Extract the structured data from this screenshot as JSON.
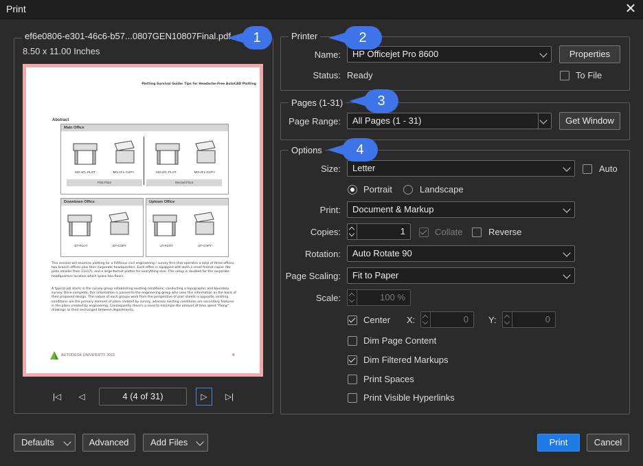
{
  "window": {
    "title": "Print",
    "close_icon": "close-icon"
  },
  "preview": {
    "file_name": "ef6e0806-e301-46c6-b57...0807GEN10807Final.pdf",
    "page_size": "8.50  x  11.00 Inches",
    "page_indicator": "4 (4 of 31)",
    "doc": {
      "header": "Plotting Survival Guide: Tips for Headache-Free AutoCAD Plotting",
      "heading": "Abstract",
      "main_office": "Main Office",
      "downtown_office": "Downtown Office",
      "uptown_office": "Uptown Office",
      "labels": [
        "MO-1FL-PLOT",
        "MO-1FL-COPY",
        "MO-2FL-PLOT",
        "MO-2FL-COPY",
        "DT-PLOT",
        "DT-COPY",
        "UT-PLOT",
        "UT-COPY"
      ],
      "first_floor": "First Floor",
      "second_floor": "Second Floor",
      "para1": "This session will examine plotting for a fictitious civil engineering / survey firm that operates a total of three offices; two branch offices plus their corporate headquarters. Each office is equipped with both a small format copier (for plots smaller than 11x17), and a large format plotter for everything else. This setup is doubled for the corporate headquarters location which spans two floors.",
      "para2": "A typical job starts in the survey group establishing existing conditions; conducting a topographic and boundary survey. Once complete, this information is passed to the engineering group who uses this information as the basis of their proposed design. The nature of each groups work from the perspective of plan sheets is opposite; existing conditions are the primary element of plans created by survey, whereas existing conditions are secondary features in the plans created by engineering. Consequently there's a need to minimize the amount of time spent \"fixing\" drawings as their exchanged between departments.",
      "footer_logo": "AUTODESK UNIVERSITY 2015",
      "page_number": "4"
    }
  },
  "printer": {
    "legend": "Printer",
    "name_label": "Name:",
    "name_value": "HP Officejet Pro 8600",
    "properties_button": "Properties",
    "status_label": "Status:",
    "status_value": "Ready",
    "to_file_label": "To File",
    "to_file_checked": false
  },
  "pages": {
    "legend": "Pages (1-31)",
    "range_label": "Page Range:",
    "range_value": "All Pages (1 - 31)",
    "get_window_button": "Get Window"
  },
  "options": {
    "legend": "Options",
    "size_label": "Size:",
    "size_value": "Letter",
    "auto_label": "Auto",
    "auto_checked": false,
    "portrait_label": "Portrait",
    "landscape_label": "Landscape",
    "orientation": "portrait",
    "print_label": "Print:",
    "print_value": "Document & Markup",
    "copies_label": "Copies:",
    "copies_value": "1",
    "collate_label": "Collate",
    "collate_checked": true,
    "reverse_label": "Reverse",
    "reverse_checked": false,
    "rotation_label": "Rotation:",
    "rotation_value": "Auto Rotate 90",
    "scaling_label": "Page Scaling:",
    "scaling_value": "Fit to Paper",
    "scale_label": "Scale:",
    "scale_value": "100 %",
    "center_label": "Center",
    "center_checked": true,
    "x_label": "X:",
    "x_value": "0",
    "y_label": "Y:",
    "y_value": "0",
    "dim_page_label": "Dim Page Content",
    "dim_page_checked": false,
    "dim_markups_label": "Dim Filtered Markups",
    "dim_markups_checked": true,
    "print_spaces_label": "Print Spaces",
    "print_spaces_checked": false,
    "print_hyperlinks_label": "Print Visible Hyperlinks",
    "print_hyperlinks_checked": false
  },
  "footer": {
    "defaults_button": "Defaults",
    "advanced_button": "Advanced",
    "add_files_button": "Add Files",
    "print_button": "Print",
    "cancel_button": "Cancel"
  },
  "callouts": [
    "1",
    "2",
    "3",
    "4"
  ],
  "colors": {
    "accent": "#1f7ae6",
    "callout": "#3f73e8",
    "page_border": "#f3a9a9"
  }
}
